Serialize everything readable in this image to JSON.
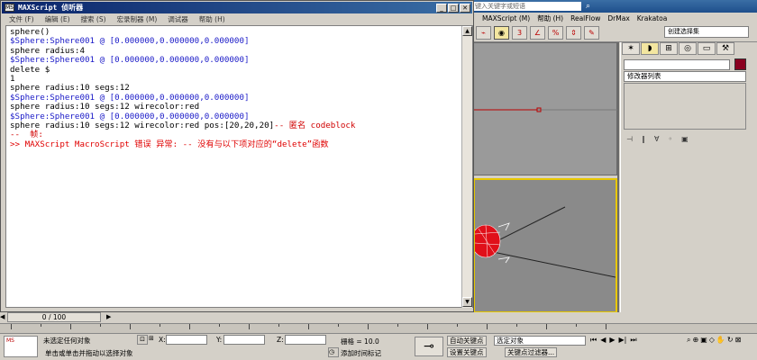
{
  "max_app": {
    "menus": [
      "MAXScript (M)",
      "帮助 (H)",
      "RealFlow",
      "DrMax",
      "Krakatoa"
    ],
    "search_hint": "键入关键字或短语",
    "selection_set_placeholder": "创建选择集",
    "modifier_list_label": "修改器列表",
    "time_slider": "0 / 100",
    "status": {
      "selection_msg": "未选定任何对象",
      "prompt_msg": "单击或单击并拖动以选择对象",
      "x_label": "X:",
      "y_label": "Y:",
      "z_label": "Z:",
      "grid_label": "栅格 = 10.0",
      "add_time_tag": "添加时间标记",
      "auto_key": "自动关键点",
      "set_key": "设置关键点",
      "selected_dropdown": "选定对象",
      "key_filters": "关键点过滤器..."
    }
  },
  "listener": {
    "title": "MAXScript 侦听器",
    "title_icon": "MS",
    "menus": [
      "文件 (F)",
      "编辑 (E)",
      "搜索 (S)",
      "宏录制器 (M)",
      "调试器",
      "帮助 (H)"
    ],
    "lines": [
      {
        "kind": "input",
        "text": "sphere()"
      },
      {
        "kind": "output",
        "text": "$Sphere:Sphere001 @ [0.000000,0.000000,0.000000]"
      },
      {
        "kind": "input",
        "text": "sphere radius:4"
      },
      {
        "kind": "output",
        "text": "$Sphere:Sphere001 @ [0.000000,0.000000,0.000000]"
      },
      {
        "kind": "input",
        "text": "delete $"
      },
      {
        "kind": "input",
        "text": "1"
      },
      {
        "kind": "input",
        "text": "sphere radius:10 segs:12"
      },
      {
        "kind": "output",
        "text": "$Sphere:Sphere001 @ [0.000000,0.000000,0.000000]"
      },
      {
        "kind": "input",
        "text": "sphere radius:10 segs:12 wirecolor:red"
      },
      {
        "kind": "output",
        "text": "$Sphere:Sphere001 @ [0.000000,0.000000,0.000000]"
      },
      {
        "kind": "input",
        "text": "sphere radius:10 segs:12 wirecolor:red pos:[20,20,20]",
        "comment": "-- 匿名 codeblock"
      },
      {
        "kind": "comment",
        "text": "--  帧:"
      },
      {
        "kind": "error",
        "text": ">> MAXScript MacroScript 错误 异常: -- 没有与以下项对应的“delete”函数"
      }
    ]
  }
}
